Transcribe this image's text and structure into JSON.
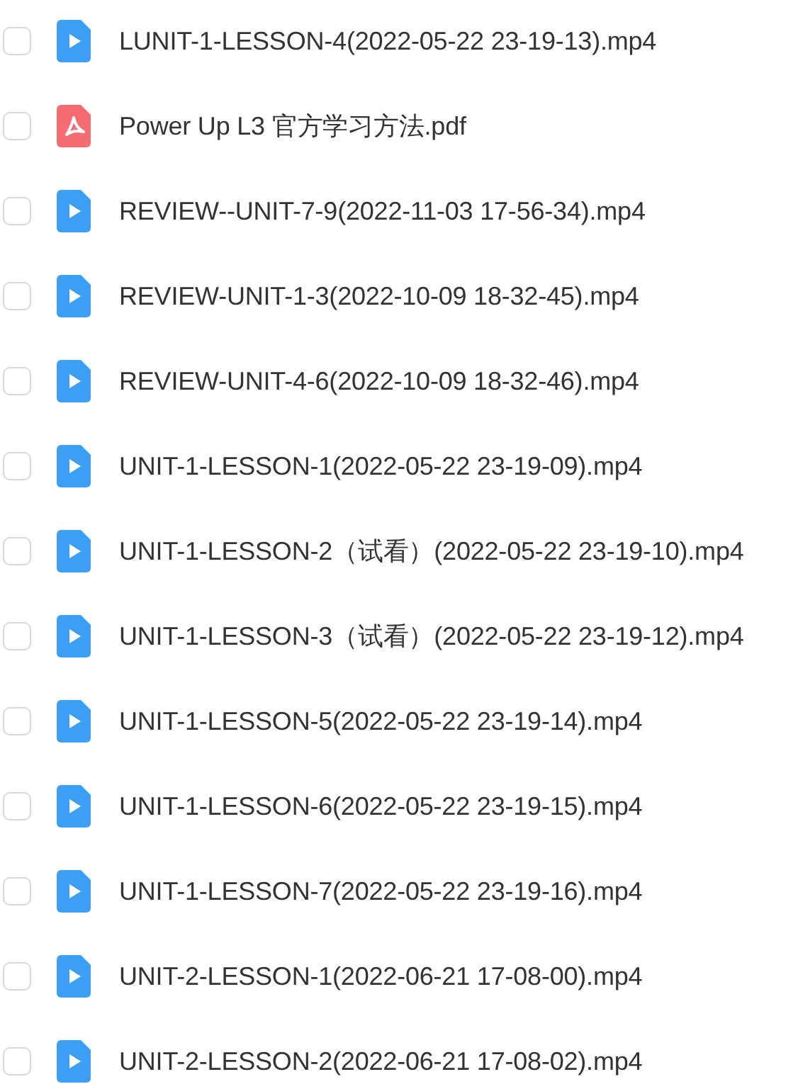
{
  "files": [
    {
      "name": "LUNIT-1-LESSON-4(2022-05-22 23-19-13).mp4",
      "kind": "video",
      "checked": false
    },
    {
      "name": "Power Up L3 官方学习方法.pdf",
      "kind": "pdf",
      "checked": false
    },
    {
      "name": "REVIEW--UNIT-7-9(2022-11-03 17-56-34).mp4",
      "kind": "video",
      "checked": false
    },
    {
      "name": "REVIEW-UNIT-1-3(2022-10-09 18-32-45).mp4",
      "kind": "video",
      "checked": false
    },
    {
      "name": "REVIEW-UNIT-4-6(2022-10-09 18-32-46).mp4",
      "kind": "video",
      "checked": false
    },
    {
      "name": "UNIT-1-LESSON-1(2022-05-22 23-19-09).mp4",
      "kind": "video",
      "checked": false
    },
    {
      "name": "UNIT-1-LESSON-2（试看）(2022-05-22 23-19-10).mp4",
      "kind": "video",
      "checked": false
    },
    {
      "name": "UNIT-1-LESSON-3（试看）(2022-05-22 23-19-12).mp4",
      "kind": "video",
      "checked": false
    },
    {
      "name": "UNIT-1-LESSON-5(2022-05-22 23-19-14).mp4",
      "kind": "video",
      "checked": false
    },
    {
      "name": "UNIT-1-LESSON-6(2022-05-22 23-19-15).mp4",
      "kind": "video",
      "checked": false
    },
    {
      "name": "UNIT-1-LESSON-7(2022-05-22 23-19-16).mp4",
      "kind": "video",
      "checked": false
    },
    {
      "name": "UNIT-2-LESSON-1(2022-06-21 17-08-00).mp4",
      "kind": "video",
      "checked": false
    },
    {
      "name": "UNIT-2-LESSON-2(2022-06-21 17-08-02).mp4",
      "kind": "video",
      "checked": false
    }
  ]
}
